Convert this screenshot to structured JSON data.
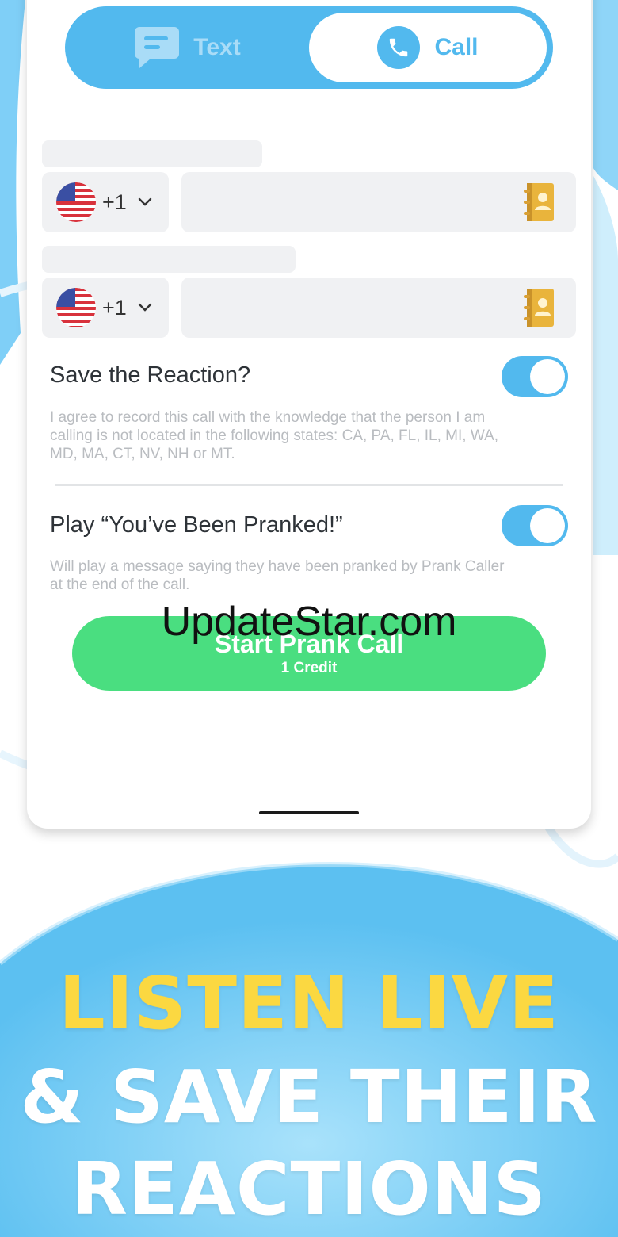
{
  "tabs": {
    "text_label": "Text",
    "call_label": "Call"
  },
  "rows": [
    {
      "dial_code": "+1",
      "number_value": ""
    },
    {
      "dial_code": "+1",
      "number_value": ""
    }
  ],
  "options": [
    {
      "title": "Save the Reaction?",
      "description": "I agree to record this call with the knowledge that the person I am calling is not located in the following states: CA, PA, FL, IL, MI, WA, MD, MA, CT, NV, NH or MT.",
      "enabled": true
    },
    {
      "title": "Play “You’ve Been Pranked!”",
      "description": "Will play a message saying they have been pranked by Prank Caller at the end of the call.",
      "enabled": true
    }
  ],
  "cta": {
    "label": "Start Prank Call",
    "sublabel": "1 Credit"
  },
  "watermark": "UpdateStar.com",
  "headline": {
    "line1": "LISTEN LIVE",
    "line2": "& SAVE THEIR",
    "line3": "REACTIONS"
  },
  "colors": {
    "accent_blue": "#52b9ee",
    "cta_green": "#4ade80",
    "headline_yellow": "#fbd841"
  }
}
